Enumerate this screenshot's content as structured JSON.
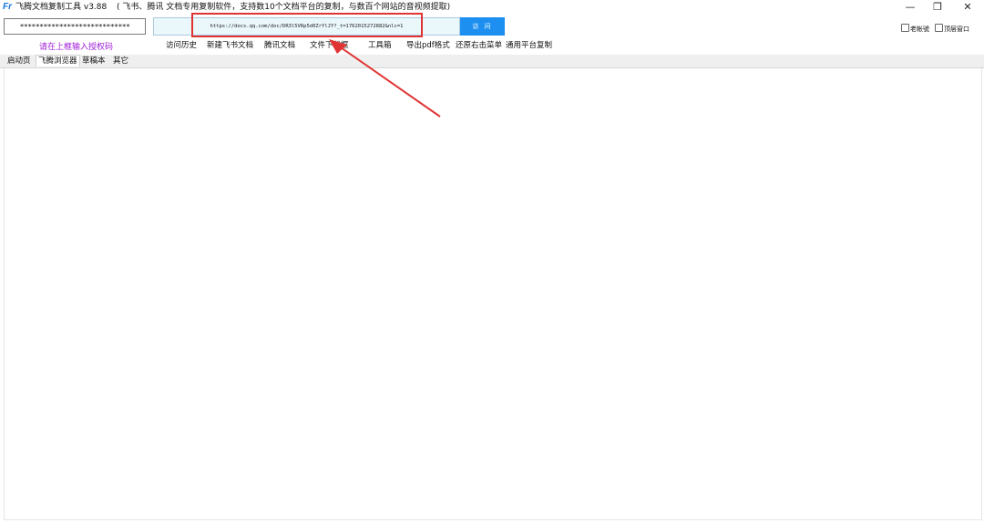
{
  "window": {
    "logo_text": "Fr",
    "title": "飞腾文档复制工具 v3.88",
    "subtitle": "( 飞书、腾讯 文档专用复制软件，支持数10个文档平台的复制，与数百个网站的音视频提取)",
    "minimize_icon": "—",
    "restore_icon": "❐",
    "close_icon": "✕"
  },
  "license": {
    "value": "****************************",
    "hint": "请在上框输入授权码"
  },
  "url_bar": {
    "value": "https://docs.qq.com/doc/DR3l5VRp5d0ZrYlJY?_t=1762015272882&nlc=1",
    "visit_label": "访 问"
  },
  "menu": {
    "items": [
      "访问历史",
      "新建飞书文档",
      "腾讯文档",
      "文件下载框",
      "工具箱",
      "导出pdf格式",
      "还原右击菜单",
      "通用平台复制"
    ]
  },
  "options": {
    "checkbox1": "老帐號",
    "checkbox2": "顶层窗口"
  },
  "tabs": [
    "启动页",
    "飞腾浏览器",
    "草稿本",
    "其它"
  ],
  "colors": {
    "accent": "#1c8ff0",
    "annotation": "#e03434",
    "hint": "#a020d8"
  }
}
